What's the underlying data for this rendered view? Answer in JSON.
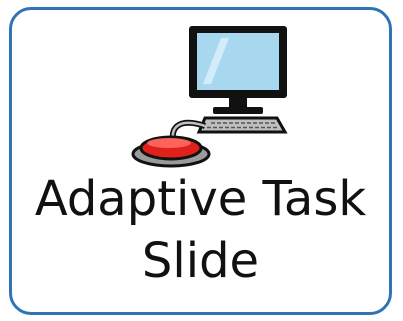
{
  "card": {
    "label_line1": "Adaptive Task",
    "label_line2": "Slide",
    "symbol": "computer-with-switch-icon",
    "colors": {
      "border": "#2f75b5",
      "switch": "#e0201b",
      "screen": "#a8d8f0"
    }
  }
}
